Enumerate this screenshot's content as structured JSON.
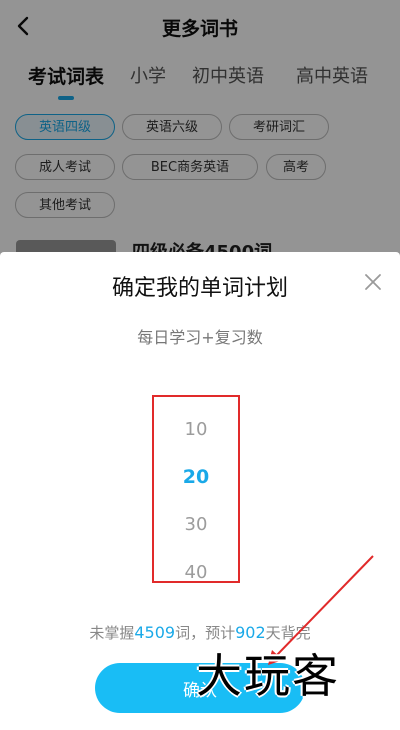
{
  "header": {
    "title": "更多词书",
    "back_icon": "chevron-left-icon"
  },
  "tabs": [
    {
      "label": "考试词表",
      "active": true
    },
    {
      "label": "小学",
      "active": false
    },
    {
      "label": "初中英语",
      "active": false
    },
    {
      "label": "高中英语",
      "active": false
    }
  ],
  "chips": [
    {
      "label": "英语四级",
      "selected": true
    },
    {
      "label": "英语六级",
      "selected": false
    },
    {
      "label": "考研词汇",
      "selected": false
    },
    {
      "label": "成人考试",
      "selected": false
    },
    {
      "label": "BEC商务英语",
      "selected": false
    },
    {
      "label": "高考",
      "selected": false
    },
    {
      "label": "其他考试",
      "selected": false
    }
  ],
  "book_peek": {
    "title": "四级必备4500词"
  },
  "sheet": {
    "title": "确定我的单词计划",
    "close_icon": "close-icon",
    "subtitle": "每日学习+复习数",
    "picker": {
      "options": [
        "10",
        "20",
        "30",
        "40"
      ],
      "selected": "20"
    },
    "summary": {
      "prefix": "未掌握",
      "unmastered_count": "4509",
      "middle": "词，预计",
      "days": "902",
      "suffix": "天背完"
    },
    "confirm_label": "确认"
  },
  "watermark": {
    "text": "大玩客"
  },
  "colors": {
    "accent": "#1aa9e8",
    "button": "#19bdf5",
    "highlight_box": "#e12a2a"
  }
}
